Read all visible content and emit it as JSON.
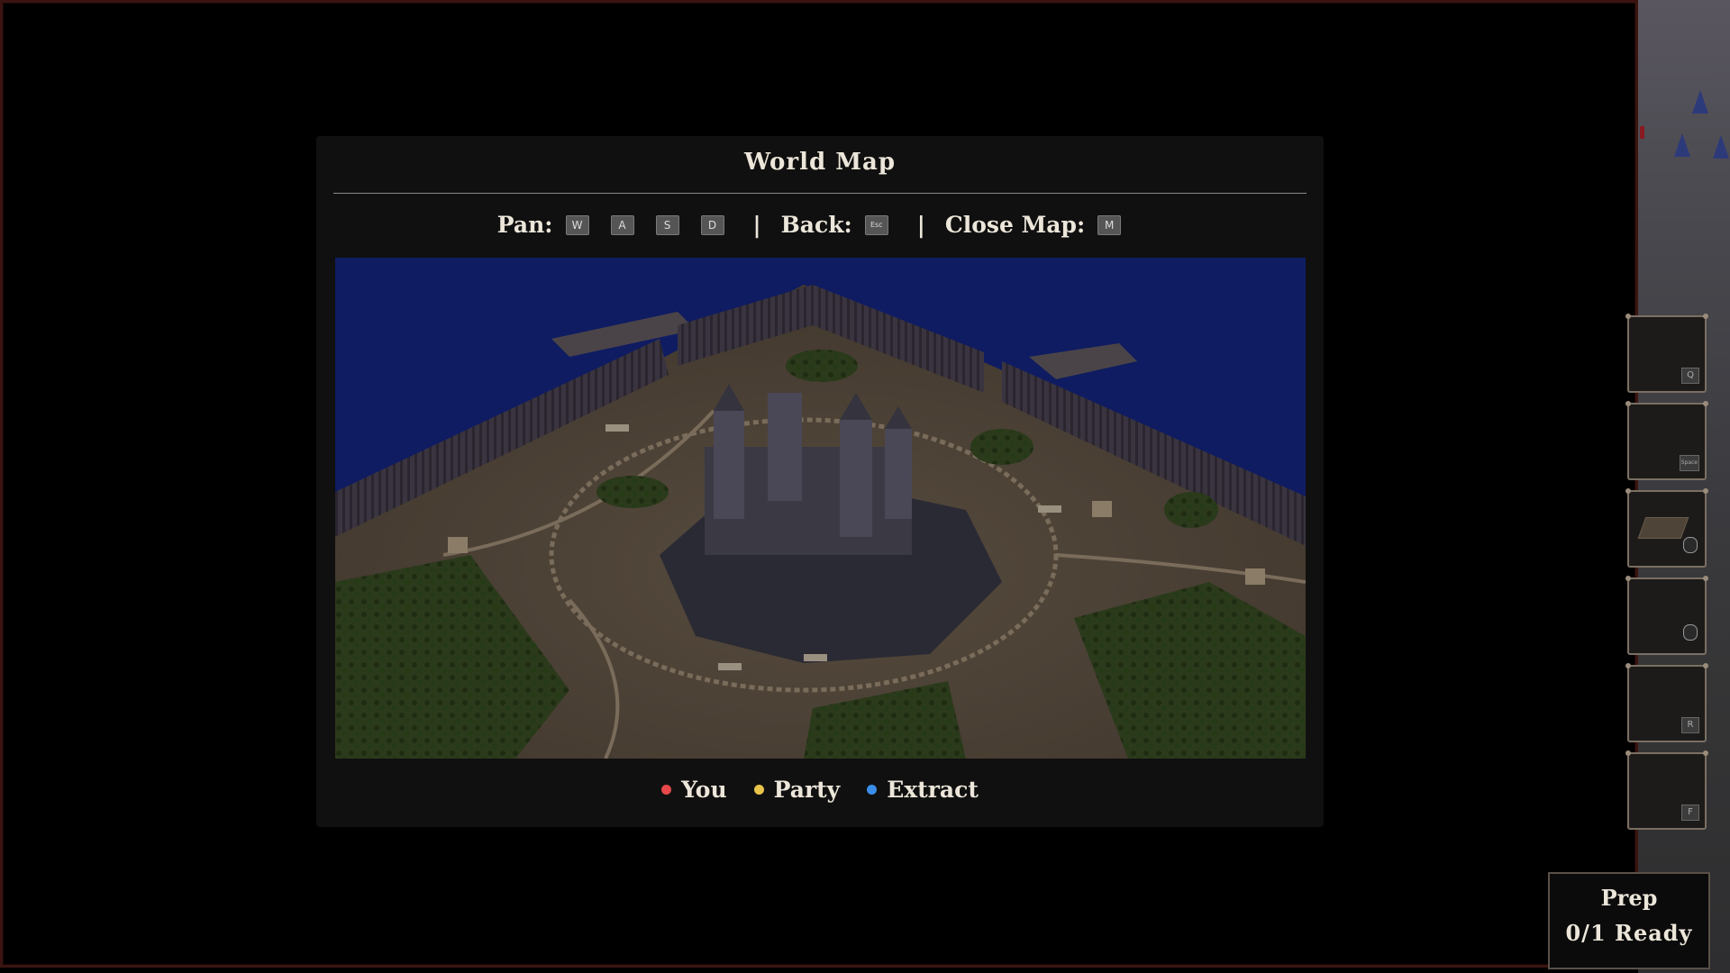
{
  "world_map": {
    "title": "World Map",
    "controls": {
      "pan_label": "Pan:",
      "pan_keys": [
        "W",
        "A",
        "S",
        "D"
      ],
      "separator": "|",
      "back_label": "Back:",
      "back_key": "Esc",
      "close_label": "Close Map:",
      "close_key": "M"
    },
    "legend": [
      {
        "label": "You",
        "color": "#e8484a"
      },
      {
        "label": "Party",
        "color": "#e8c44a"
      },
      {
        "label": "Extract",
        "color": "#3a8ee8"
      }
    ]
  },
  "ability_slots": [
    {
      "key": "Q"
    },
    {
      "key": "Space"
    },
    {
      "key": ""
    },
    {
      "key": ""
    },
    {
      "key": "R"
    },
    {
      "key": "F"
    }
  ],
  "prep": {
    "title": "Prep",
    "status": "0/1 Ready"
  },
  "colors": {
    "panel_bg": "#111010",
    "water": "#0e1a5a",
    "ground": "#4a3f33",
    "frame_border": "#3a1410"
  },
  "icons": {
    "map": "castle-island-map-image",
    "mouse": "mouse-button-icon"
  }
}
